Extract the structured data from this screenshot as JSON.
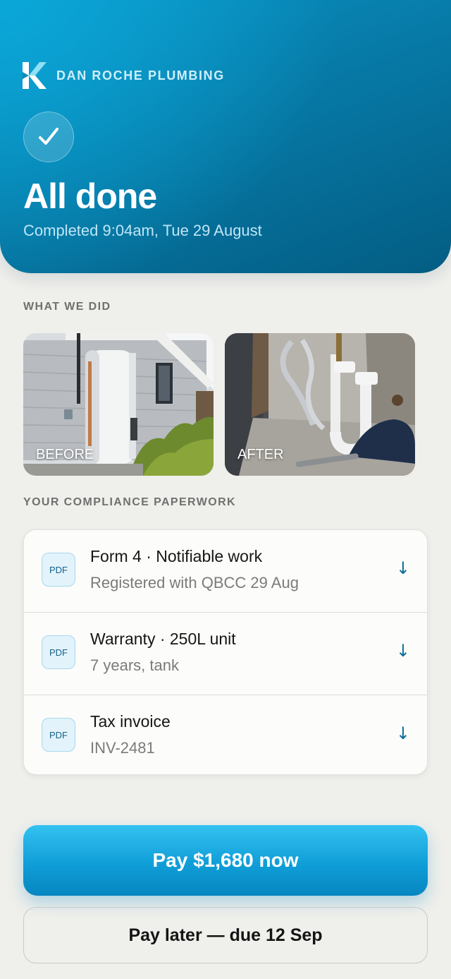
{
  "header": {
    "brand_name": "DAN ROCHE PLUMBING",
    "title": "All done",
    "subtitle": "Completed 9:04am, Tue 29 August",
    "check_glyph": "✓"
  },
  "sections": {
    "what_we_did": "WHAT WE DID",
    "paperwork": "YOUR COMPLIANCE PAPERWORK"
  },
  "photos": [
    {
      "label": "BEFORE",
      "icon": "hot-water-tank-photo"
    },
    {
      "label": "AFTER",
      "icon": "pipework-photo"
    }
  ],
  "documents": [
    {
      "badge": "PDF",
      "title": "Form 4 · Notifiable work",
      "subtitle": "Registered with QBCC 29 Aug",
      "download_icon": "↓"
    },
    {
      "badge": "PDF",
      "title": "Warranty · 250L unit",
      "subtitle": "7 years, tank",
      "download_icon": "↓"
    },
    {
      "badge": "PDF",
      "title": "Tax invoice",
      "subtitle": "INV-2481",
      "download_icon": "↓"
    }
  ],
  "actions": {
    "pay_now": "Pay $1,680 now",
    "pay_later": "Pay later — due 12 Sep"
  },
  "colors": {
    "brand": "#0779a6",
    "accent": "#109ed8",
    "background": "#efefeb"
  }
}
